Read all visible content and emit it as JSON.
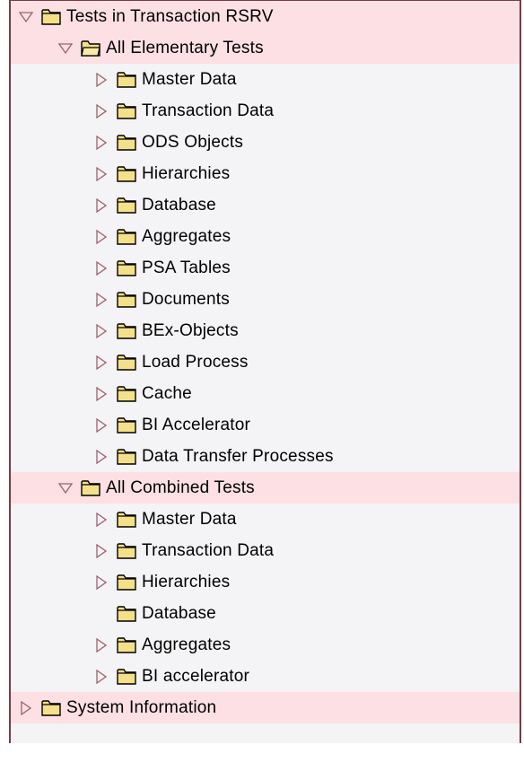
{
  "colors": {
    "panel_bg": "#f4f3f5",
    "highlight_bg": "#fce0e4",
    "border": "#7a3b45",
    "folder_fill": "#f5e08a",
    "folder_stroke": "#000000",
    "arrow_stroke": "#a0606a"
  },
  "tree": {
    "root_label": "Tests in Transaction RSRV",
    "elementary": {
      "label": "All Elementary Tests",
      "items": [
        {
          "label": "Master Data"
        },
        {
          "label": "Transaction Data"
        },
        {
          "label": "ODS Objects"
        },
        {
          "label": "Hierarchies"
        },
        {
          "label": "Database"
        },
        {
          "label": "Aggregates"
        },
        {
          "label": "PSA Tables"
        },
        {
          "label": "Documents"
        },
        {
          "label": "BEx-Objects"
        },
        {
          "label": "Load Process"
        },
        {
          "label": "Cache"
        },
        {
          "label": "BI Accelerator"
        },
        {
          "label": "Data Transfer Processes"
        }
      ]
    },
    "combined": {
      "label": "All Combined Tests",
      "items": [
        {
          "label": "Master Data",
          "expandable": true
        },
        {
          "label": "Transaction Data",
          "expandable": true
        },
        {
          "label": "Hierarchies",
          "expandable": true
        },
        {
          "label": "Database",
          "expandable": false
        },
        {
          "label": "Aggregates",
          "expandable": true
        },
        {
          "label": "BI accelerator",
          "expandable": true
        }
      ]
    },
    "system_info_label": "System Information"
  }
}
